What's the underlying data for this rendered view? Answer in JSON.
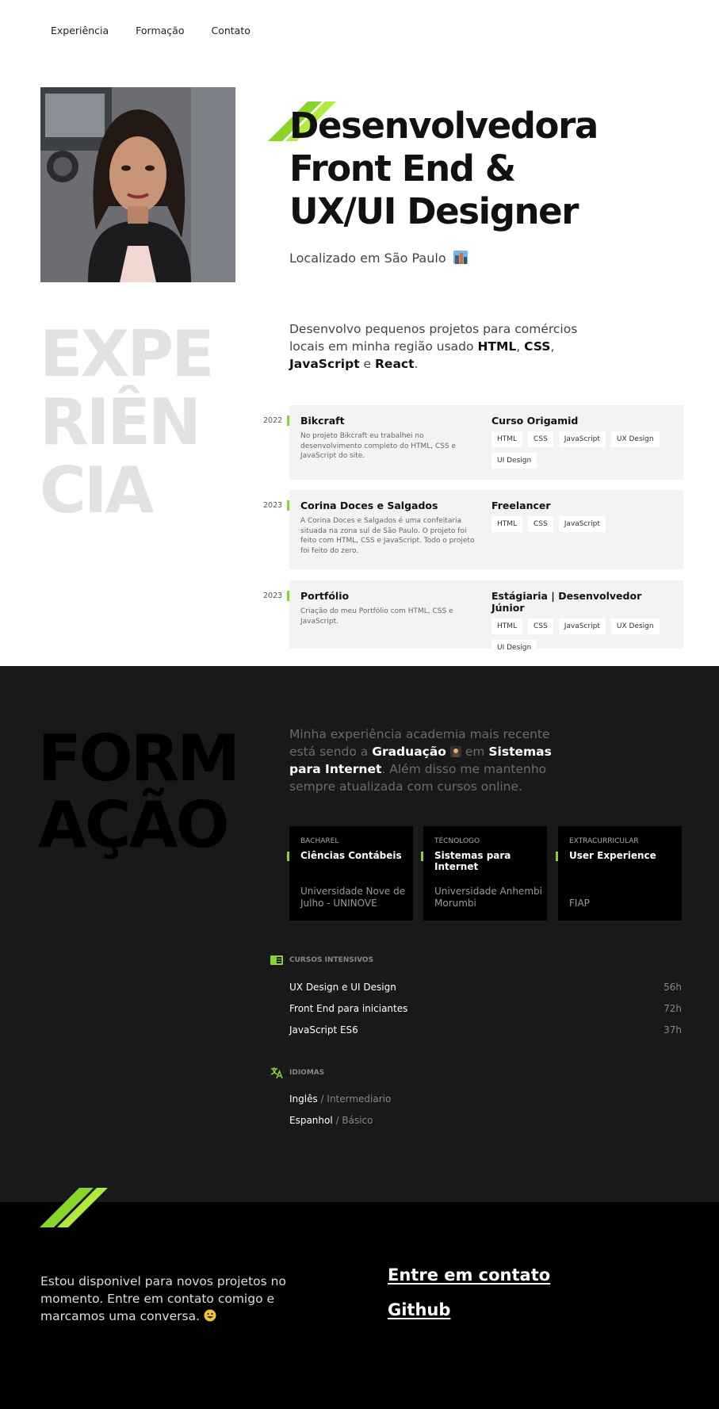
{
  "nav": {
    "items": [
      "Experiência",
      "Formação",
      "Contato"
    ]
  },
  "hero": {
    "title_lines": [
      "Desenvolvedora",
      "Front End &",
      "UX/UI Designer"
    ],
    "location": "Localizado em São Paulo",
    "photo_alt": "Foto de perfil"
  },
  "experience": {
    "big_title_lines": [
      "EXPE",
      "RIÊN",
      "CIA"
    ],
    "intro": {
      "text1": "Desenvolvo pequenos projetos para comércios locais em minha região usado ",
      "html": "HTML",
      "sep1": ", ",
      "css": "CSS",
      "sep2": ",",
      "js": "JavaScript",
      "conj": " e ",
      "react": "React",
      "end": "."
    },
    "jobs": [
      {
        "year": "2022",
        "name": "Bikcraft",
        "desc": "No projeto Bikcraft eu trabalhei no desenvolvimento completo do HTML, CSS e JavaScript do site.",
        "role": "Curso Origamid",
        "tags": [
          "HTML",
          "CSS",
          "JavaScript",
          "UX Design",
          "UI Design"
        ]
      },
      {
        "year": "2023",
        "name": "Corina Doces e Salgados",
        "desc": "A Corina Doces e Salgados é uma confeitaria situada na zona sul de São Paulo. O projeto foi feito com HTML, CSS e JavaScript. Todo o projeto foi feito do zero.",
        "role": "Freelancer",
        "tags": [
          "HTML",
          "CSS",
          "JavaScript"
        ]
      },
      {
        "year": "2023",
        "name": "Portfólio",
        "desc": "Criação do meu Portfólio com HTML, CSS e JavaScript.",
        "role": "Estágiaria | Desenvolvedor Júnior",
        "tags": [
          "HTML",
          "CSS",
          "JavaScript",
          "UX Design",
          "UI Design"
        ]
      }
    ]
  },
  "formation": {
    "big_title_lines": [
      "FORM",
      "AÇÃO"
    ],
    "intro": {
      "text1": "Minha experiência academia mais recente está sendo a ",
      "grad": "Graduação",
      "text2": " em ",
      "course": "Sistemas para Internet",
      "text3": ". Além disso me mantenho sempre atualizada com cursos online."
    },
    "degrees": [
      {
        "level": "BACHAREL",
        "course": "Ciências Contábeis",
        "institution": "Universidade Nove de Julho - UNINOVE"
      },
      {
        "level": "TÉCNOLOGO",
        "course": "Sistemas para Internet",
        "institution": "Universidade Anhembi Morumbi"
      },
      {
        "level": "EXTRACURRICULAR",
        "course": "User Experience",
        "institution": "FIAP"
      }
    ],
    "courses_title": "CURSOS INTENSIVOS",
    "courses": [
      {
        "name": "UX Design e UI Design",
        "hours": "56h"
      },
      {
        "name": "Front End para iniciantes",
        "hours": "72h"
      },
      {
        "name": "JavaScript ES6",
        "hours": "37h"
      }
    ],
    "languages_title": "IDIOMAS",
    "languages": [
      {
        "name": "Inglês",
        "sep": " / ",
        "level": "Intermediario"
      },
      {
        "name": "Espanhol",
        "sep": " / ",
        "level": "Básico"
      }
    ]
  },
  "footer": {
    "text": "Estou disponivel para novos projetos no momento. Entre em contato comigo e marcamos uma conversa.",
    "contact_link": "Entre em contato",
    "github_link": "Github"
  },
  "colors": {
    "accent": "#88d42b",
    "accent_light": "#b4ea3e",
    "dark_bg": "#19191a",
    "footer_bg": "#000000"
  }
}
